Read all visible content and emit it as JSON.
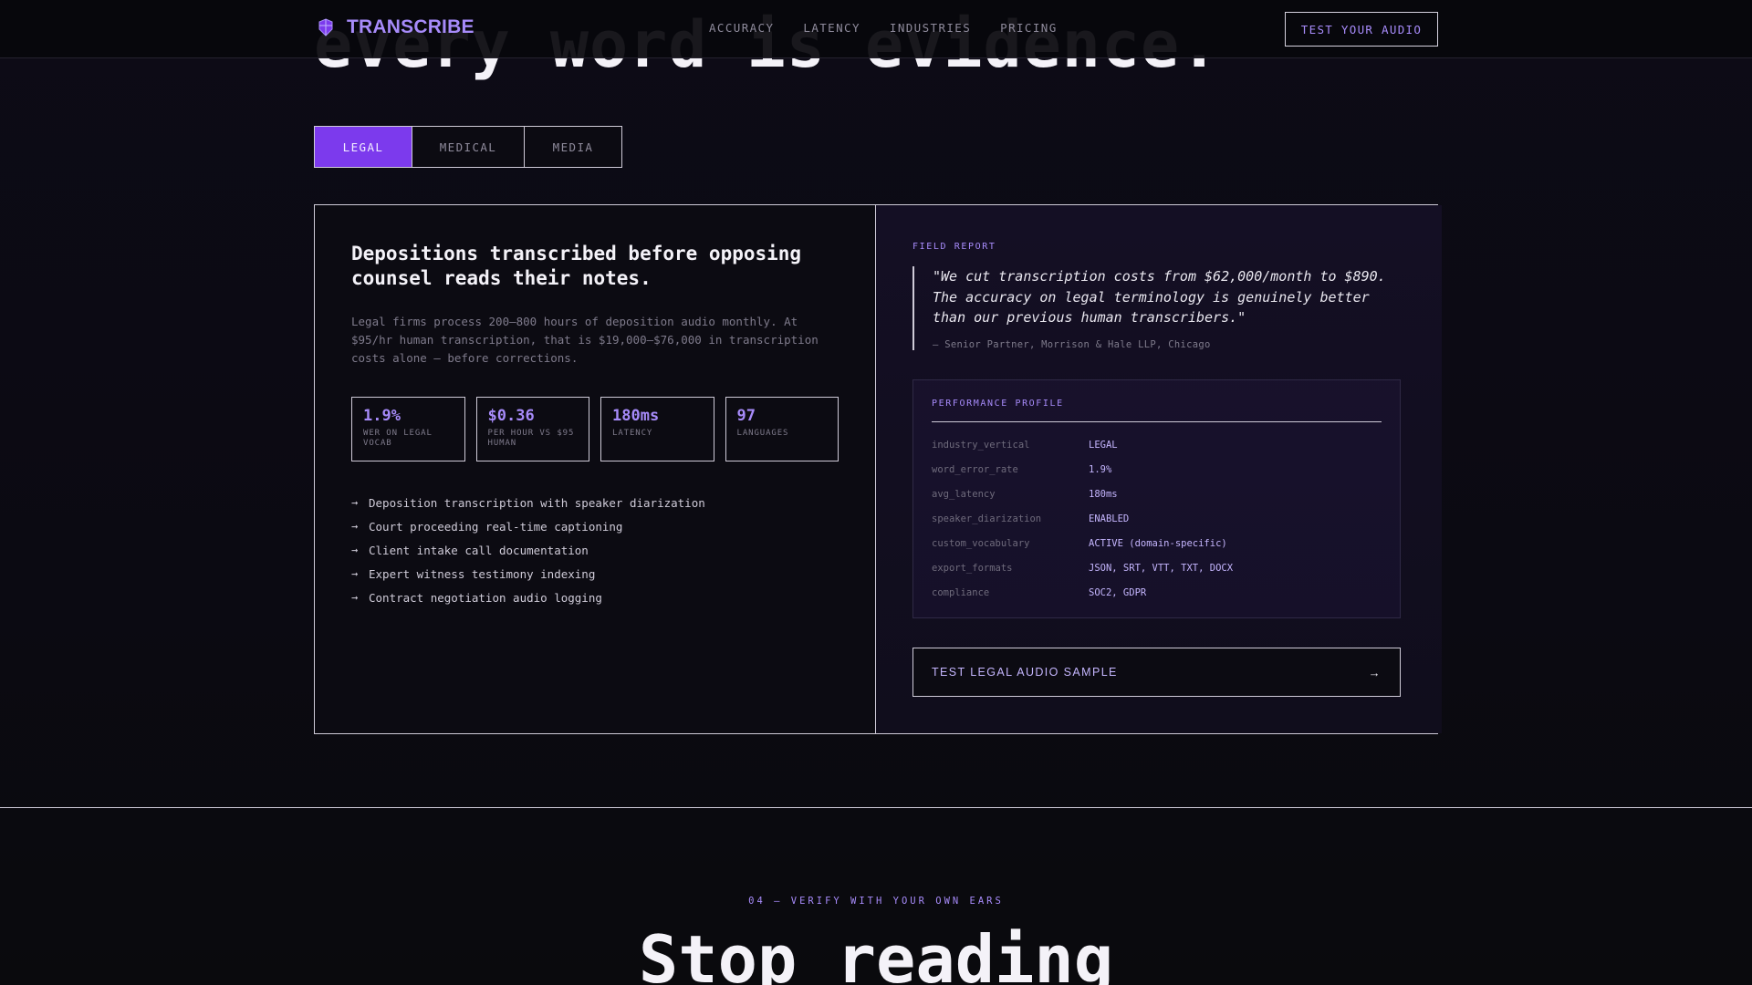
{
  "hero": {
    "title_partial": "every word is evidence."
  },
  "nav": {
    "brand": "TRANSCRIBE",
    "links": [
      "ACCURACY",
      "LATENCY",
      "INDUSTRIES",
      "PRICING"
    ],
    "cta": "TEST YOUR AUDIO",
    "colors": {
      "accent": "#a78bfa"
    }
  },
  "tabs": {
    "items": [
      "LEGAL",
      "MEDICAL",
      "MEDIA"
    ],
    "active": "LEGAL",
    "active_color": "#7c3aed"
  },
  "industry": {
    "headline": "Depositions transcribed before opposing counsel reads their notes.",
    "description": "Legal firms process 200–800 hours of deposition audio monthly. At $95/hr human transcription, that is $19,000–$76,000 in transcription costs alone — before corrections.",
    "stats": [
      {
        "value": "1.9%",
        "label": "WER ON LEGAL VOCAB"
      },
      {
        "value": "$0.36",
        "label": "PER HOUR VS $95 HUMAN"
      },
      {
        "value": "180ms",
        "label": "LATENCY"
      },
      {
        "value": "97",
        "label": "LANGUAGES"
      }
    ],
    "use_cases": [
      "Deposition transcription with speaker diarization",
      "Court proceeding real-time captioning",
      "Client intake call documentation",
      "Expert witness testimony indexing",
      "Contract negotiation audio logging"
    ],
    "arrow_glyph": "→"
  },
  "field_report": {
    "eyebrow": "FIELD REPORT",
    "quote": "\"We cut transcription costs from $62,000/month to $890. The accuracy on legal terminology is genuinely better than our previous human transcribers.\"",
    "attribution": "— Senior Partner, Morrison & Hale LLP, Chicago"
  },
  "profile": {
    "title": "PERFORMANCE PROFILE",
    "rows": [
      {
        "key": "industry_vertical",
        "value": "LEGAL"
      },
      {
        "key": "word_error_rate",
        "value": "1.9%"
      },
      {
        "key": "avg_latency",
        "value": "180ms"
      },
      {
        "key": "speaker_diarization",
        "value": "ENABLED"
      },
      {
        "key": "custom_vocabulary",
        "value": "ACTIVE (domain-specific)"
      },
      {
        "key": "export_formats",
        "value": "JSON, SRT, VTT, TXT, DOCX"
      },
      {
        "key": "compliance",
        "value": "SOC2, GDPR"
      }
    ]
  },
  "sample_button": {
    "label": "TEST LEGAL AUDIO SAMPLE",
    "arrow": "→"
  },
  "next_section": {
    "eyebrow": "04 — VERIFY WITH YOUR OWN EARS",
    "title_partial": "Stop reading"
  }
}
